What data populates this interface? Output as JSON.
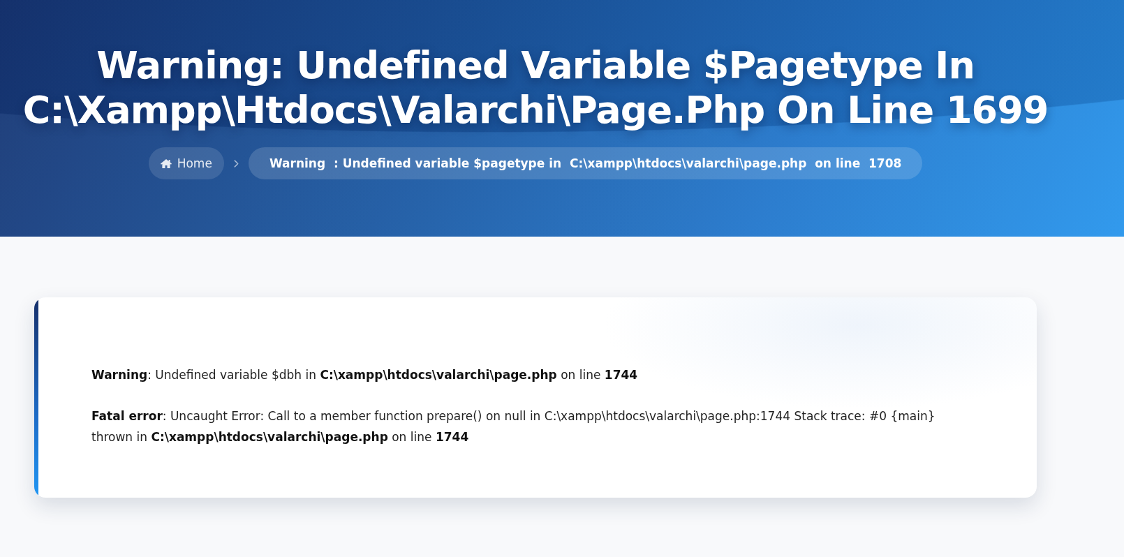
{
  "header": {
    "title_lines": [
      "Warning: Undefined Variable $Pagetype In",
      "C:\\Xampp\\Htdocs\\Valarchi\\Page.Php On Line 1699"
    ],
    "breadcrumb": [
      {
        "kind": "home",
        "label": "Home"
      },
      {
        "kind": "current",
        "label": "Warning  : Undefined variable $pagetype in  C:\\xampp\\htdocs\\valarchi\\page.php  on line  1708"
      }
    ]
  },
  "notice": {
    "paragraphs": [
      "**Warning**: Undefined variable $dbh in **C:\\xampp\\htdocs\\valarchi\\page.php** on line **1744**",
      "**Fatal error**: Uncaught Error: Call to a member function prepare() on null in C:\\xampp\\htdocs\\valarchi\\page.php:1744 Stack trace: #0 {main} thrown in **C:\\xampp\\htdocs\\valarchi\\page.php** on line **1744**"
    ]
  }
}
